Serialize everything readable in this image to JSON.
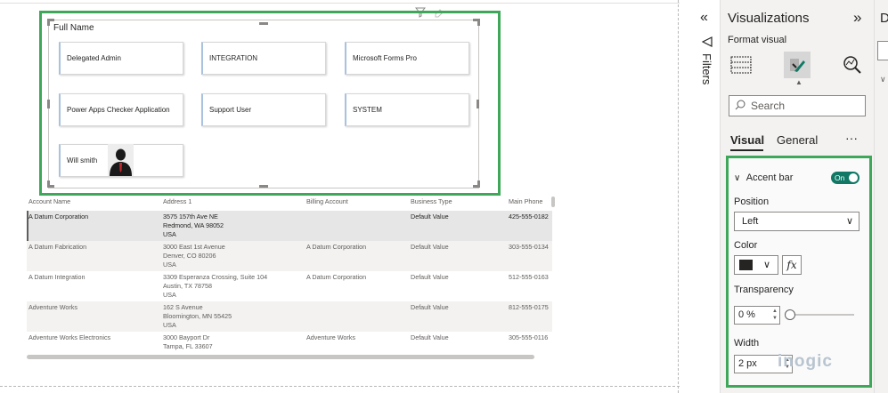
{
  "slicer": {
    "title": "Full Name",
    "cards": [
      "Delegated Admin",
      "INTEGRATION",
      "Microsoft Forms Pro",
      "Power Apps Checker Application",
      "Support User",
      "SYSTEM",
      "Will smith"
    ]
  },
  "table": {
    "headers": [
      "Account Name",
      "Address 1",
      "Billing Account",
      "Business Type",
      "Main Phone"
    ],
    "rows": [
      {
        "name": "A Datum Corporation",
        "addr1": "3575 157th Ave NE",
        "addr2": "Redmond, WA 98052",
        "addr3": "USA",
        "billing": "",
        "type": "Default Value",
        "phone": "425-555-0182"
      },
      {
        "name": "A Datum Fabrication",
        "addr1": "3000 East 1st Avenue",
        "addr2": "Denver, CO 80206",
        "addr3": "USA",
        "billing": "A Datum Corporation",
        "type": "Default Value",
        "phone": "303-555-0134"
      },
      {
        "name": "A Datum Integration",
        "addr1": "3309 Esperanza Crossing, Suite 104",
        "addr2": "Austin, TX 78758",
        "addr3": "USA",
        "billing": "A Datum Corporation",
        "type": "Default Value",
        "phone": "512-555-0163"
      },
      {
        "name": "Adventure Works",
        "addr1": "162 S Avenue",
        "addr2": "Bloomington, MN 55425",
        "addr3": "USA",
        "billing": "",
        "type": "Default Value",
        "phone": "812-555-0175"
      },
      {
        "name": "Adventure Works Electronics",
        "addr1": "3000 Bayport Dr",
        "addr2": "Tampa, FL 33607",
        "addr3": "",
        "billing": "Adventure Works",
        "type": "Default Value",
        "phone": "305-555-0116"
      }
    ]
  },
  "filters": {
    "label": "Filters",
    "collapse_icon": "«"
  },
  "viz": {
    "title": "Visualizations",
    "expand_icon": "»",
    "subtitle": "Format visual",
    "search_placeholder": "Search",
    "tabs": [
      "Visual",
      "General"
    ],
    "more": "···",
    "section": {
      "title": "Accent bar",
      "toggle": "On",
      "position_label": "Position",
      "position_value": "Left",
      "color_label": "Color",
      "color_value": "#252423",
      "fx": "fx",
      "transparency_label": "Transparency",
      "transparency_value": "0 %",
      "width_label": "Width",
      "width_value": "2 px"
    }
  },
  "data_pane": {
    "label": "D"
  },
  "watermark": "inogic",
  "colors": {
    "accent_green": "#3fa75a",
    "toggle_on": "#117865"
  }
}
